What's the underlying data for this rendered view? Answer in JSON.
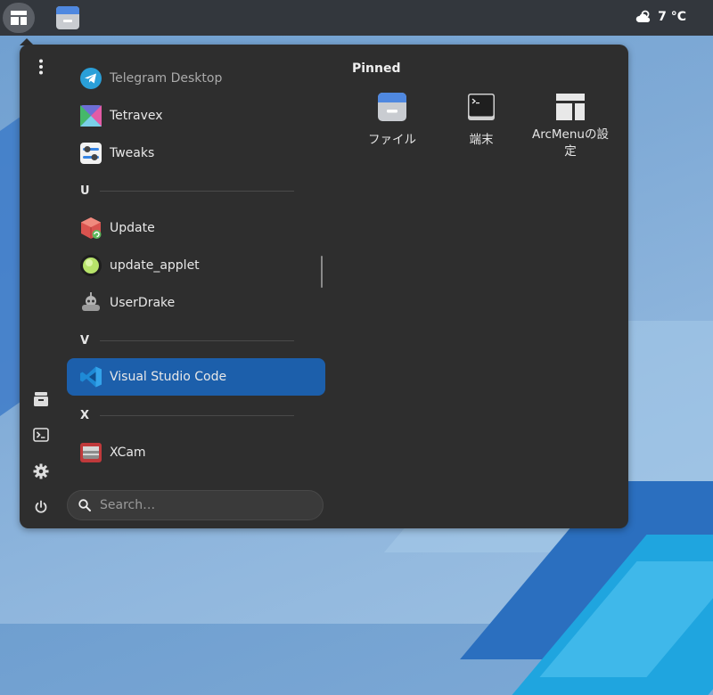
{
  "panel": {
    "weather_temp": "7 °C"
  },
  "sidebar": {
    "buttons": [
      "more-options",
      "files",
      "terminal",
      "settings",
      "power"
    ]
  },
  "apps": [
    {
      "label": "Telegram Desktop",
      "icon": "telegram-icon"
    },
    {
      "label": "Tetravex",
      "icon": "tetravex-icon"
    },
    {
      "label": "Tweaks",
      "icon": "tweaks-icon"
    },
    {
      "label": "Update",
      "icon": "update-icon"
    },
    {
      "label": "update_applet",
      "icon": "update-applet-icon"
    },
    {
      "label": "UserDrake",
      "icon": "userdrake-icon"
    },
    {
      "label": "Visual Studio Code",
      "icon": "vscode-icon",
      "selected": true
    },
    {
      "label": "XCam",
      "icon": "xcam-icon"
    }
  ],
  "sections": [
    "U",
    "V",
    "X"
  ],
  "search": {
    "placeholder": "Search…"
  },
  "pinned": {
    "title": "Pinned",
    "items": [
      {
        "label": "ファイル",
        "icon": "files-icon"
      },
      {
        "label": "端末",
        "icon": "terminal-icon"
      },
      {
        "label": "ArcMenuの設定",
        "icon": "arcmenu-settings-icon"
      }
    ]
  },
  "colors": {
    "panel": "#33373d",
    "menu_bg": "#2e2e2e",
    "selection": "#1c5fab"
  }
}
